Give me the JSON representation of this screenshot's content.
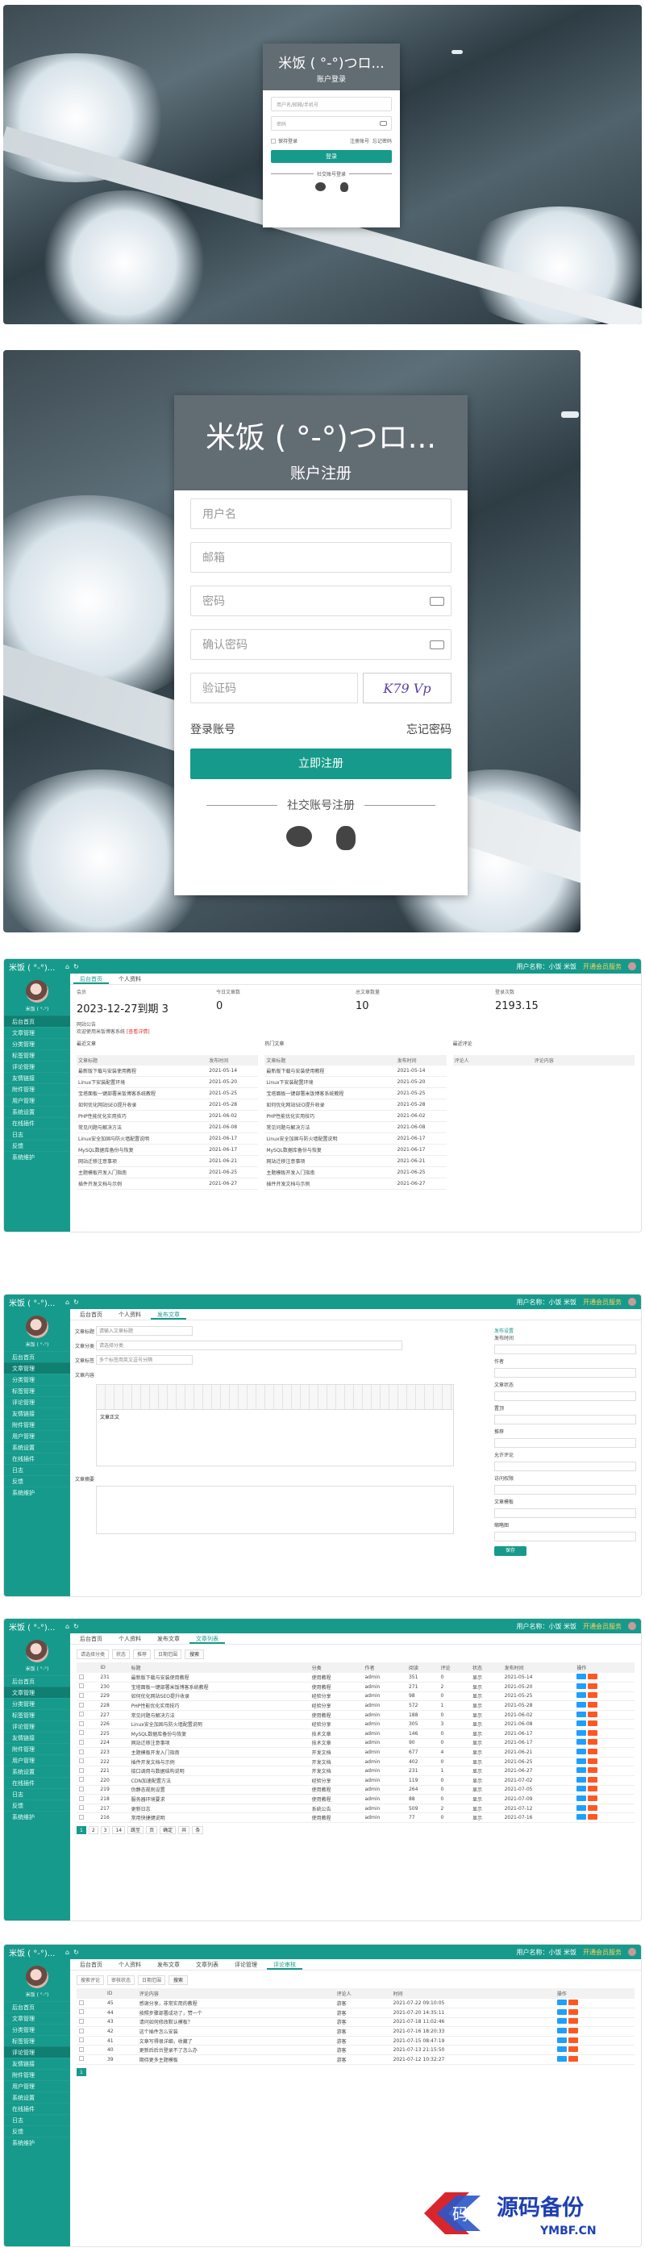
{
  "login_small": {
    "title": "米饭 ( °-°)つロ...",
    "subtitle": "账户登录",
    "username_placeholder": "用户名/邮箱/手机号",
    "password_placeholder": "密码",
    "remember": "保持登录",
    "register_link": "注册账号",
    "forgot_link": "忘记密码",
    "submit": "登录",
    "social": "社交账号登录"
  },
  "register": {
    "title": "米饭 ( °-°)つロ...",
    "subtitle": "账户注册",
    "username_placeholder": "用户名",
    "email_placeholder": "邮箱",
    "password_placeholder": "密码",
    "confirm_placeholder": "确认密码",
    "captcha_placeholder": "验证码",
    "captcha_text": "K79 Vp",
    "login_link": "登录账号",
    "forgot_link": "忘记密码",
    "submit": "立即注册",
    "social": "社交账号注册"
  },
  "admin": {
    "brand": "米饭 ( °-°)...",
    "user_text": "用户名称：小饭 米饭",
    "warn_text": "开通会员服务",
    "avatar_name": "米饭 ( °-°)",
    "sidebar": [
      "后台首页",
      "文章管理",
      "分类管理",
      "标签管理",
      "评论管理",
      "友情链接",
      "附件管理",
      "用户管理",
      "系统设置",
      "在线插件",
      "日志",
      "反馈",
      "系统维护"
    ],
    "dashboard": {
      "tabs": [
        "后台首页",
        "个人资料"
      ],
      "stats": [
        {
          "label": "会员",
          "value": "2023-12-27到期  3"
        },
        {
          "label": "今日文章数",
          "value": "0"
        },
        {
          "label": "总文章数量",
          "value": "10"
        },
        {
          "label": "登录次数",
          "value": "2193.15"
        }
      ],
      "notice_label": "网站公告",
      "notice_text": "欢迎使用米饭博客系统",
      "notice_red": "[查看详情]",
      "cols": [
        "最近文章",
        "热门文章",
        "最近评论"
      ],
      "table_head": [
        "文章标题",
        "发布时间"
      ],
      "comment_head": [
        "评论人",
        "评论内容"
      ],
      "rows": [
        [
          "最新版下载与安装使用教程",
          "2021-05-14"
        ],
        [
          "Linux下安装配置环境",
          "2021-05-20"
        ],
        [
          "宝塔面板一键部署米饭博客系统教程",
          "2021-05-25"
        ],
        [
          "如何优化网站SEO提升收录",
          "2021-05-28"
        ],
        [
          "PHP性能优化实用技巧",
          "2021-06-02"
        ],
        [
          "常见问题与解决方法",
          "2021-06-08"
        ],
        [
          "Linux安全加固与防火墙配置说明",
          "2021-06-17"
        ],
        [
          "MySQL数据库备份与恢复",
          "2021-06-17"
        ],
        [
          "网站迁移注意事项",
          "2021-06-21"
        ],
        [
          "主题模板开发入门指南",
          "2021-06-25"
        ],
        [
          "插件开发文档与示例",
          "2021-06-27"
        ]
      ]
    },
    "editor": {
      "tabs": [
        "后台首页",
        "个人资料",
        "发布文章"
      ],
      "title_label": "文章标题",
      "title_value": "请输入文章标题",
      "cat_label": "文章分类",
      "cat_value": "请选择分类",
      "tag_label": "文章标签",
      "tag_value": "多个标签用英文逗号分隔",
      "content_label": "文章内容",
      "content_value": "文章正文",
      "summary_label": "文章摘要",
      "side_title": "发布设置",
      "side_items": [
        "发布时间",
        "作者",
        "文章状态",
        "置顶",
        "推荐",
        "允许评论",
        "访问权限",
        "文章模板",
        "缩略图"
      ],
      "save": "保存"
    },
    "list": {
      "tabs": [
        "后台首页",
        "个人资料",
        "发布文章",
        "文章列表"
      ],
      "filters": [
        "请选择分类",
        "状态",
        "推荐",
        "日期范围",
        "搜索"
      ],
      "head": [
        "ID",
        "标题",
        "分类",
        "作者",
        "阅读",
        "评论",
        "状态",
        "发布时间",
        "操作"
      ],
      "rows": [
        [
          "231",
          "最新版下载与安装使用教程",
          "使用教程",
          "admin",
          "351",
          "0",
          "显示",
          "2021-05-14"
        ],
        [
          "230",
          "宝塔面板一键部署米饭博客系统教程",
          "使用教程",
          "admin",
          "271",
          "2",
          "显示",
          "2021-05-20"
        ],
        [
          "229",
          "如何优化网站SEO提升收录",
          "经验分享",
          "admin",
          "98",
          "0",
          "显示",
          "2021-05-25"
        ],
        [
          "228",
          "PHP性能优化实用技巧",
          "经验分享",
          "admin",
          "572",
          "1",
          "显示",
          "2021-05-28"
        ],
        [
          "227",
          "常见问题与解决方法",
          "使用教程",
          "admin",
          "188",
          "0",
          "显示",
          "2021-06-02"
        ],
        [
          "226",
          "Linux安全加固与防火墙配置说明",
          "经验分享",
          "admin",
          "305",
          "3",
          "显示",
          "2021-06-08"
        ],
        [
          "225",
          "MySQL数据库备份与恢复",
          "技术文章",
          "admin",
          "146",
          "0",
          "显示",
          "2021-06-17"
        ],
        [
          "224",
          "网站迁移注意事项",
          "技术文章",
          "admin",
          "90",
          "0",
          "显示",
          "2021-06-17"
        ],
        [
          "223",
          "主题模板开发入门指南",
          "开发文档",
          "admin",
          "677",
          "4",
          "显示",
          "2021-06-21"
        ],
        [
          "222",
          "插件开发文档与示例",
          "开发文档",
          "admin",
          "402",
          "0",
          "显示",
          "2021-06-25"
        ],
        [
          "221",
          "接口调用与数据结构说明",
          "开发文档",
          "admin",
          "231",
          "1",
          "显示",
          "2021-06-27"
        ],
        [
          "220",
          "CDN加速配置方法",
          "经验分享",
          "admin",
          "119",
          "0",
          "显示",
          "2021-07-02"
        ],
        [
          "219",
          "伪静态规则设置",
          "使用教程",
          "admin",
          "264",
          "0",
          "显示",
          "2021-07-05"
        ],
        [
          "218",
          "服务器环境要求",
          "使用教程",
          "admin",
          "88",
          "0",
          "显示",
          "2021-07-09"
        ],
        [
          "217",
          "更新日志",
          "系统公告",
          "admin",
          "509",
          "2",
          "显示",
          "2021-07-12"
        ],
        [
          "216",
          "常用快捷键说明",
          "使用教程",
          "admin",
          "77",
          "0",
          "显示",
          "2021-07-16"
        ]
      ],
      "pages": [
        "1",
        "2",
        "3",
        "14",
        "跳至",
        "页",
        "确定",
        "共",
        "条"
      ]
    },
    "comments": {
      "tabs": [
        "后台首页",
        "个人资料",
        "发布文章",
        "文章列表",
        "评论管理",
        "评论审核"
      ],
      "filters": [
        "搜索评论",
        "审核状态",
        "日期范围",
        "搜索"
      ],
      "head": [
        "ID",
        "评论内容",
        "评论人",
        "时间",
        "操作"
      ],
      "rows": [
        [
          "45",
          "感谢分享，非常实用的教程",
          "游客",
          "2021-07-22 09:10:05"
        ],
        [
          "44",
          "按照步骤部署成功了，赞一个",
          "游客",
          "2021-07-20 14:35:11"
        ],
        [
          "43",
          "请问如何修改默认模板？",
          "游客",
          "2021-07-18 11:02:46"
        ],
        [
          "42",
          "这个插件怎么安装",
          "游客",
          "2021-07-16 18:20:33"
        ],
        [
          "41",
          "文章写得很详细，收藏了",
          "游客",
          "2021-07-15 08:47:19"
        ],
        [
          "40",
          "更新后后台登录不了怎么办",
          "游客",
          "2021-07-13 21:15:50"
        ],
        [
          "39",
          "期待更多主题模板",
          "游客",
          "2021-07-12 10:32:27"
        ]
      ]
    }
  },
  "watermark": {
    "big": "源码备份",
    "small": "YMBF.CN",
    "glyph": "码"
  }
}
